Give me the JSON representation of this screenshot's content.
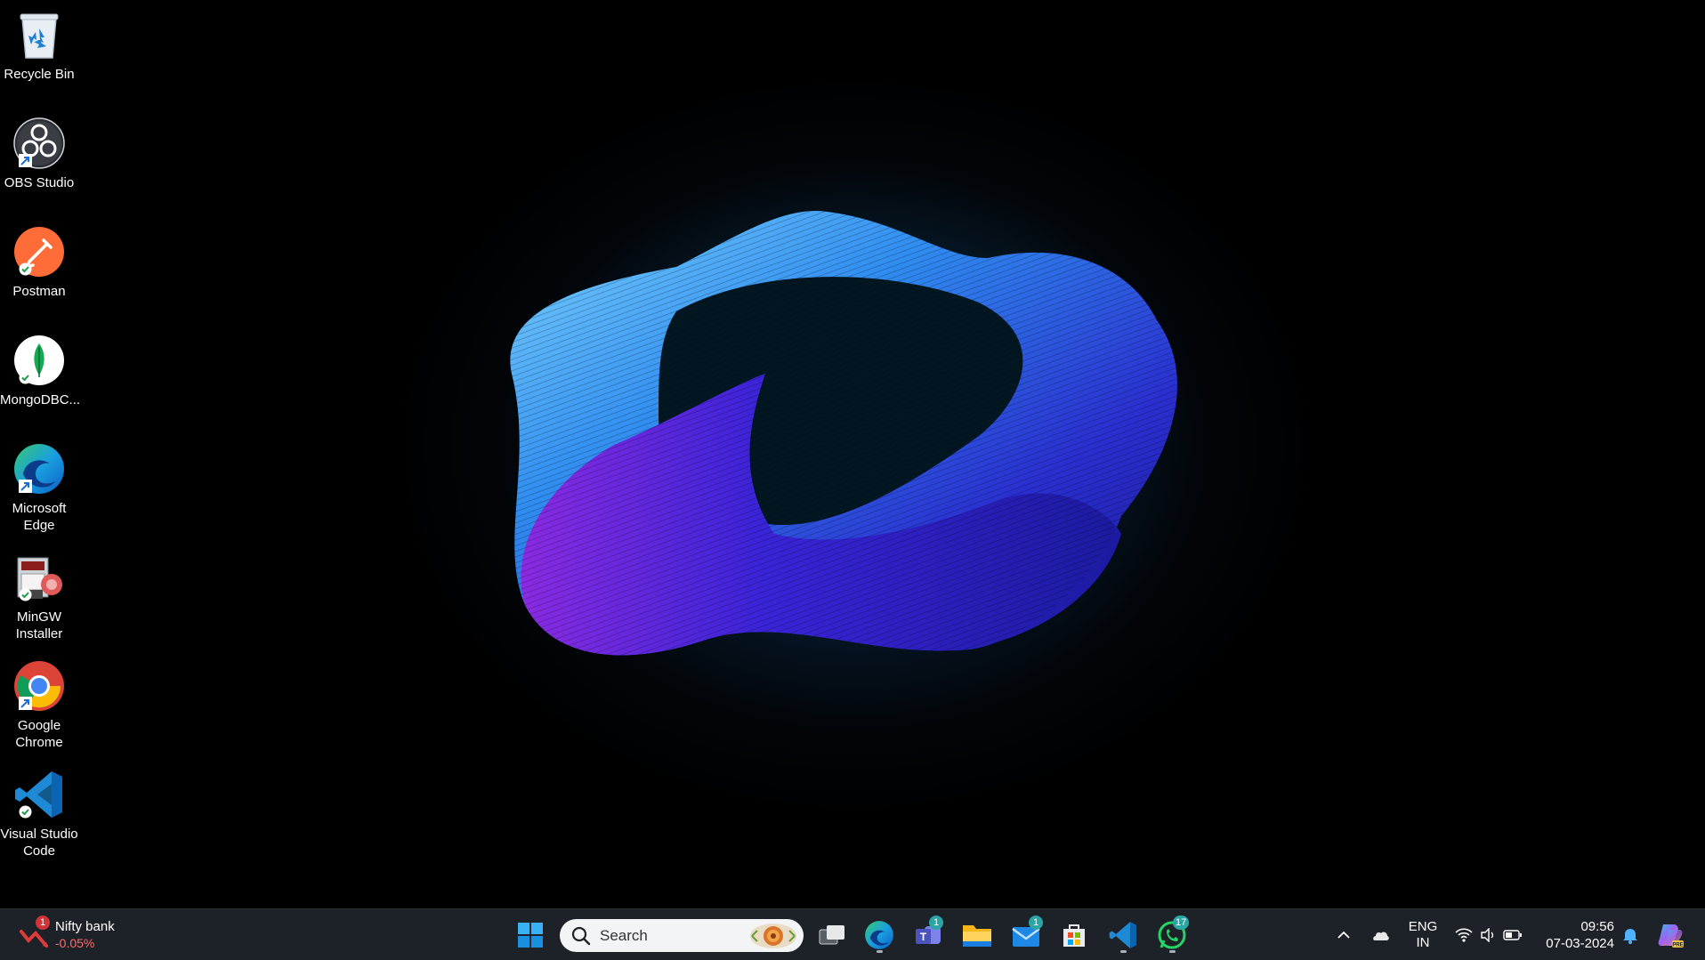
{
  "desktop": {
    "icons": [
      {
        "label": "Recycle Bin",
        "icon": "recycle-bin-icon"
      },
      {
        "label": "OBS Studio",
        "icon": "obs-studio-icon"
      },
      {
        "label": "Postman",
        "icon": "postman-icon"
      },
      {
        "label": "MongoDBC...",
        "icon": "mongodb-compass-icon"
      },
      {
        "label": "Microsoft Edge",
        "icon": "edge-icon"
      },
      {
        "label": "MinGW Installer",
        "icon": "mingw-installer-icon"
      },
      {
        "label": "Google Chrome",
        "icon": "chrome-icon"
      },
      {
        "label": "Visual Studio Code",
        "icon": "vscode-icon"
      }
    ]
  },
  "taskbar": {
    "widget": {
      "name": "Nifty bank",
      "change": "-0.05%",
      "badge": "1"
    },
    "search": {
      "placeholder": "Search"
    },
    "apps": [
      {
        "name": "start-button"
      },
      {
        "name": "task-view"
      },
      {
        "name": "edge"
      },
      {
        "name": "teams",
        "badge": "1"
      },
      {
        "name": "file-explorer"
      },
      {
        "name": "mail",
        "badge": "1"
      },
      {
        "name": "microsoft-store"
      },
      {
        "name": "vscode"
      },
      {
        "name": "whatsapp",
        "badge": "17"
      }
    ],
    "tray": {
      "lang_line1": "ENG",
      "lang_line2": "IN",
      "time": "09:56",
      "date": "07-03-2024"
    }
  },
  "colors": {
    "taskbar_bg": "#1d2228",
    "accent": "#0078d4",
    "badge_red": "#d13438",
    "badge_teal": "#2aa6a6",
    "widget_change": "#ff6b6b"
  }
}
